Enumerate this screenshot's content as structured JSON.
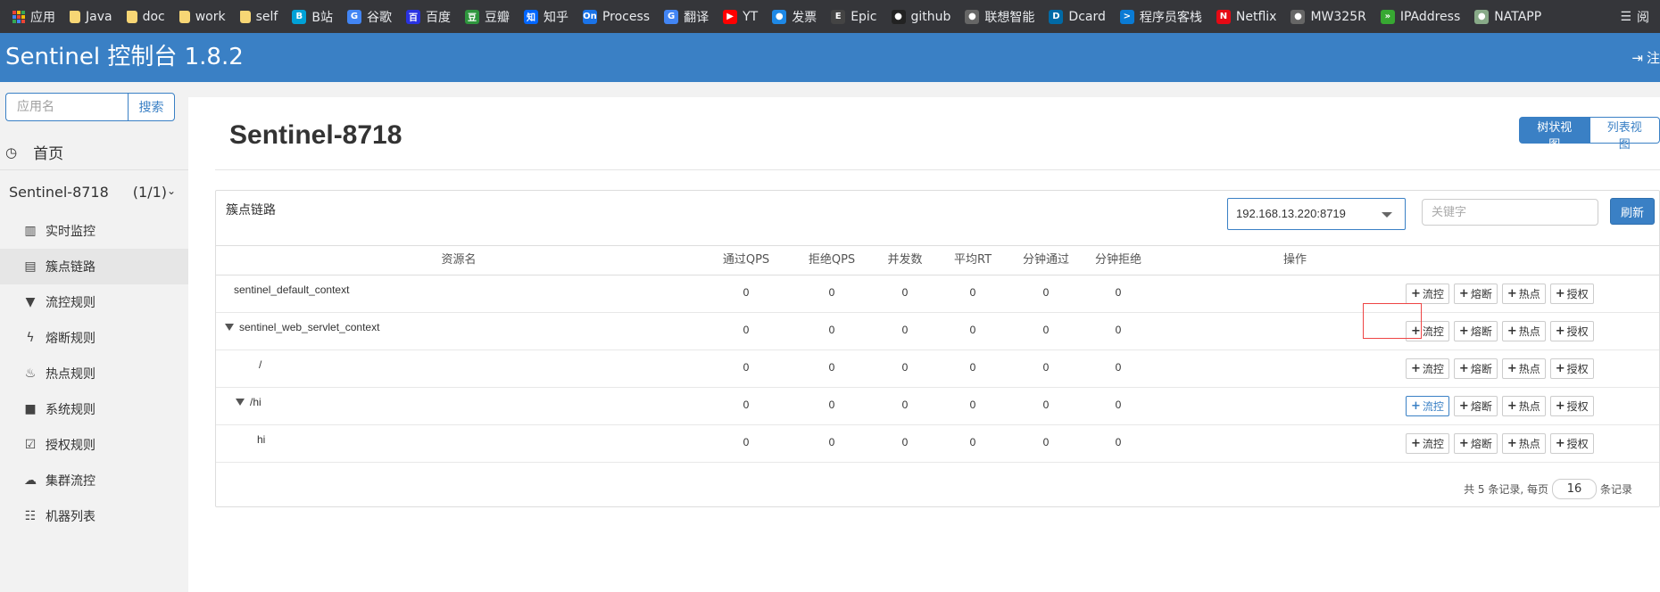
{
  "bookmarks": [
    {
      "label": "应用",
      "icon": "apps-grid-icon",
      "kind": "grid"
    },
    {
      "label": "Java",
      "icon": "folder-icon",
      "kind": "folder"
    },
    {
      "label": "doc",
      "icon": "folder-icon",
      "kind": "folder"
    },
    {
      "label": "work",
      "icon": "folder-icon",
      "kind": "folder"
    },
    {
      "label": "self",
      "icon": "folder-icon",
      "kind": "folder"
    },
    {
      "label": "B站",
      "icon": "bilibili-icon",
      "color": "#00a1d6",
      "glyph": "B"
    },
    {
      "label": "谷歌",
      "icon": "google-icon",
      "color": "#4285f4",
      "glyph": "G"
    },
    {
      "label": "百度",
      "icon": "baidu-icon",
      "color": "#2932e1",
      "glyph": "百"
    },
    {
      "label": "豆瓣",
      "icon": "douban-icon",
      "color": "#2e963d",
      "glyph": "豆"
    },
    {
      "label": "知乎",
      "icon": "zhihu-icon",
      "color": "#0066ff",
      "glyph": "知"
    },
    {
      "label": "Process",
      "icon": "processon-icon",
      "color": "#1a73e8",
      "glyph": "On"
    },
    {
      "label": "翻译",
      "icon": "translate-icon",
      "color": "#4285f4",
      "glyph": "G"
    },
    {
      "label": "YT",
      "icon": "youtube-icon",
      "color": "#ff0000",
      "glyph": "▶"
    },
    {
      "label": "发票",
      "icon": "invoice-search-icon",
      "color": "#1e88e5",
      "glyph": "●"
    },
    {
      "label": "Epic",
      "icon": "epic-icon",
      "color": "#444444",
      "glyph": "E"
    },
    {
      "label": "github",
      "icon": "github-icon",
      "color": "#222222",
      "glyph": "●"
    },
    {
      "label": "联想智能",
      "icon": "globe-icon",
      "color": "#666666",
      "glyph": "●"
    },
    {
      "label": "Dcard",
      "icon": "dcard-icon",
      "color": "#006aa6",
      "glyph": "D"
    },
    {
      "label": "程序员客栈",
      "icon": "terminal-icon",
      "color": "#0a7bd4",
      "glyph": ">"
    },
    {
      "label": "Netflix",
      "icon": "netflix-icon",
      "color": "#e50914",
      "glyph": "N"
    },
    {
      "label": "MW325R",
      "icon": "globe-icon",
      "color": "#666666",
      "glyph": "●"
    },
    {
      "label": "IPAddress",
      "icon": "ipaddress-icon",
      "color": "#37a832",
      "glyph": "»"
    },
    {
      "label": "NATAPP",
      "icon": "natapp-icon",
      "color": "#8a8",
      "glyph": "●"
    }
  ],
  "bookmarks_right": {
    "label": "阅",
    "icon": "reading-list-icon"
  },
  "header": {
    "brand": "Sentinel 控制台 1.8.2",
    "logout": "注"
  },
  "sidebar": {
    "search_placeholder": "应用名",
    "search_button": "搜索",
    "home": "首页",
    "app_name": "Sentinel-8718",
    "app_count": "(1/1)",
    "items": [
      {
        "label": "实时监控",
        "icon": "bar-chart-icon"
      },
      {
        "label": "簇点链路",
        "icon": "list-icon",
        "active": true
      },
      {
        "label": "流控规则",
        "icon": "filter-icon"
      },
      {
        "label": "熔断规则",
        "icon": "flash-icon"
      },
      {
        "label": "热点规则",
        "icon": "fire-icon"
      },
      {
        "label": "系统规则",
        "icon": "lock-icon"
      },
      {
        "label": "授权规则",
        "icon": "check-circle-icon"
      },
      {
        "label": "集群流控",
        "icon": "cloud-icon"
      },
      {
        "label": "机器列表",
        "icon": "grid-list-icon"
      }
    ]
  },
  "main": {
    "title": "Sentinel-8718",
    "view_tree": "树状视图",
    "view_list": "列表视图",
    "card_title": "簇点链路",
    "ip_value": "192.168.13.220:8719",
    "keyword_placeholder": "关键字",
    "refresh": "刷新"
  },
  "table": {
    "columns": [
      "资源名",
      "通过QPS",
      "拒绝QPS",
      "并发数",
      "平均RT",
      "分钟通过",
      "分钟拒绝",
      "操作"
    ],
    "rows": [
      {
        "name": "sentinel_default_context",
        "level": 0,
        "expanded": false,
        "values": [
          "0",
          "0",
          "0",
          "0",
          "0",
          "0"
        ]
      },
      {
        "name": "sentinel_web_servlet_context",
        "level": 0,
        "expanded": true,
        "values": [
          "0",
          "0",
          "0",
          "0",
          "0",
          "0"
        ]
      },
      {
        "name": "/",
        "level": 1,
        "expanded": false,
        "values": [
          "0",
          "0",
          "0",
          "0",
          "0",
          "0"
        ]
      },
      {
        "name": "/hi",
        "level": 1,
        "expanded": true,
        "values": [
          "0",
          "0",
          "0",
          "0",
          "0",
          "0"
        ]
      },
      {
        "name": "hi",
        "level": 2,
        "expanded": false,
        "values": [
          "0",
          "0",
          "0",
          "0",
          "0",
          "0"
        ]
      }
    ],
    "actions": [
      "流控",
      "熔断",
      "热点",
      "授权"
    ],
    "highlight_row": 3
  },
  "pager": {
    "summary": "共 5 条记录, 每页",
    "page_size": "16",
    "unit": "条记录"
  }
}
